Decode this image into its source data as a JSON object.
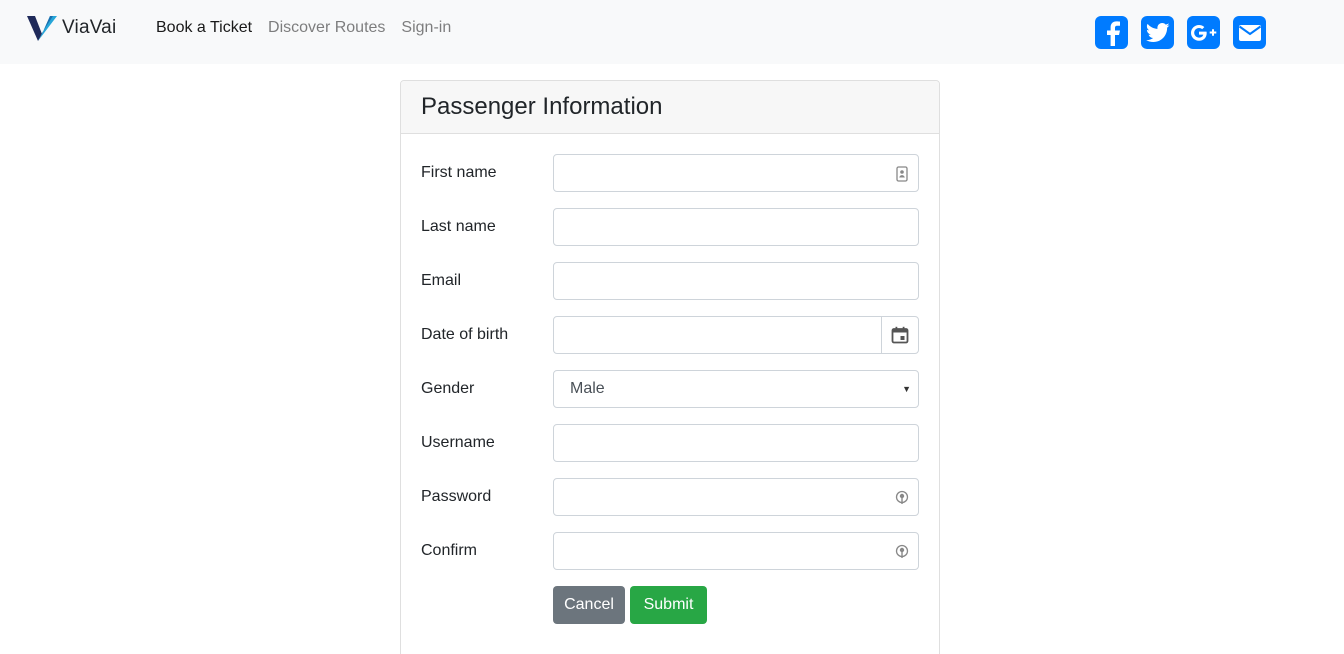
{
  "brand": {
    "name": "ViaVai",
    "logo_icon": "viavai-v-logo-icon"
  },
  "nav": {
    "links": [
      {
        "label": "Book a Ticket",
        "active": true
      },
      {
        "label": "Discover Routes",
        "active": false
      },
      {
        "label": "Sign-in",
        "active": false
      }
    ]
  },
  "social": [
    {
      "name": "facebook",
      "icon": "facebook-icon"
    },
    {
      "name": "twitter",
      "icon": "twitter-icon"
    },
    {
      "name": "google-plus",
      "icon": "google-plus-icon",
      "glyph": "G+"
    },
    {
      "name": "email",
      "icon": "envelope-icon"
    }
  ],
  "colors": {
    "accent": "#007bff",
    "cancel": "#6c757d",
    "submit": "#28a745",
    "navbar_bg": "#f8f9fa"
  },
  "form": {
    "title": "Passenger Information",
    "fields": {
      "first_name": {
        "label": "First name",
        "value": ""
      },
      "last_name": {
        "label": "Last name",
        "value": ""
      },
      "email": {
        "label": "Email",
        "value": ""
      },
      "dob": {
        "label": "Date of birth",
        "value": ""
      },
      "gender": {
        "label": "Gender",
        "value": "Male"
      },
      "username": {
        "label": "Username",
        "value": ""
      },
      "password": {
        "label": "Password",
        "value": ""
      },
      "confirm": {
        "label": "Confirm",
        "value": ""
      }
    },
    "buttons": {
      "cancel": "Cancel",
      "submit": "Submit"
    }
  }
}
